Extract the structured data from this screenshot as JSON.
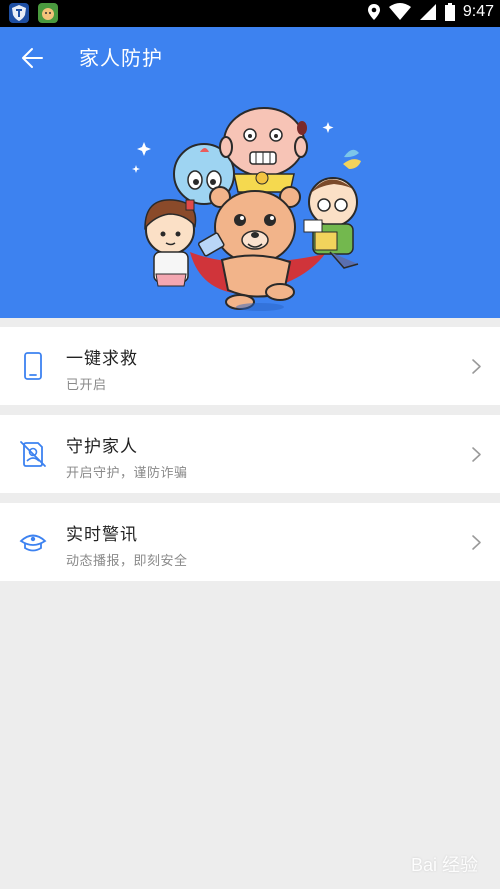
{
  "status_bar": {
    "time": "9:47"
  },
  "header": {
    "title": "家人防护"
  },
  "cards": [
    {
      "title": "一键求救",
      "subtitle": "已开启",
      "icon": "phone-icon"
    },
    {
      "title": "守护家人",
      "subtitle": "开启守护，谨防诈骗",
      "icon": "guard-family-icon"
    },
    {
      "title": "实时警讯",
      "subtitle": "动态播报，即刻安全",
      "icon": "police-cap-icon"
    }
  ],
  "watermark": {
    "text": "Bai 经验"
  },
  "colors": {
    "header_bg": "#3d82f0",
    "page_bg": "#ededed",
    "icon_blue": "#3d82f0"
  }
}
